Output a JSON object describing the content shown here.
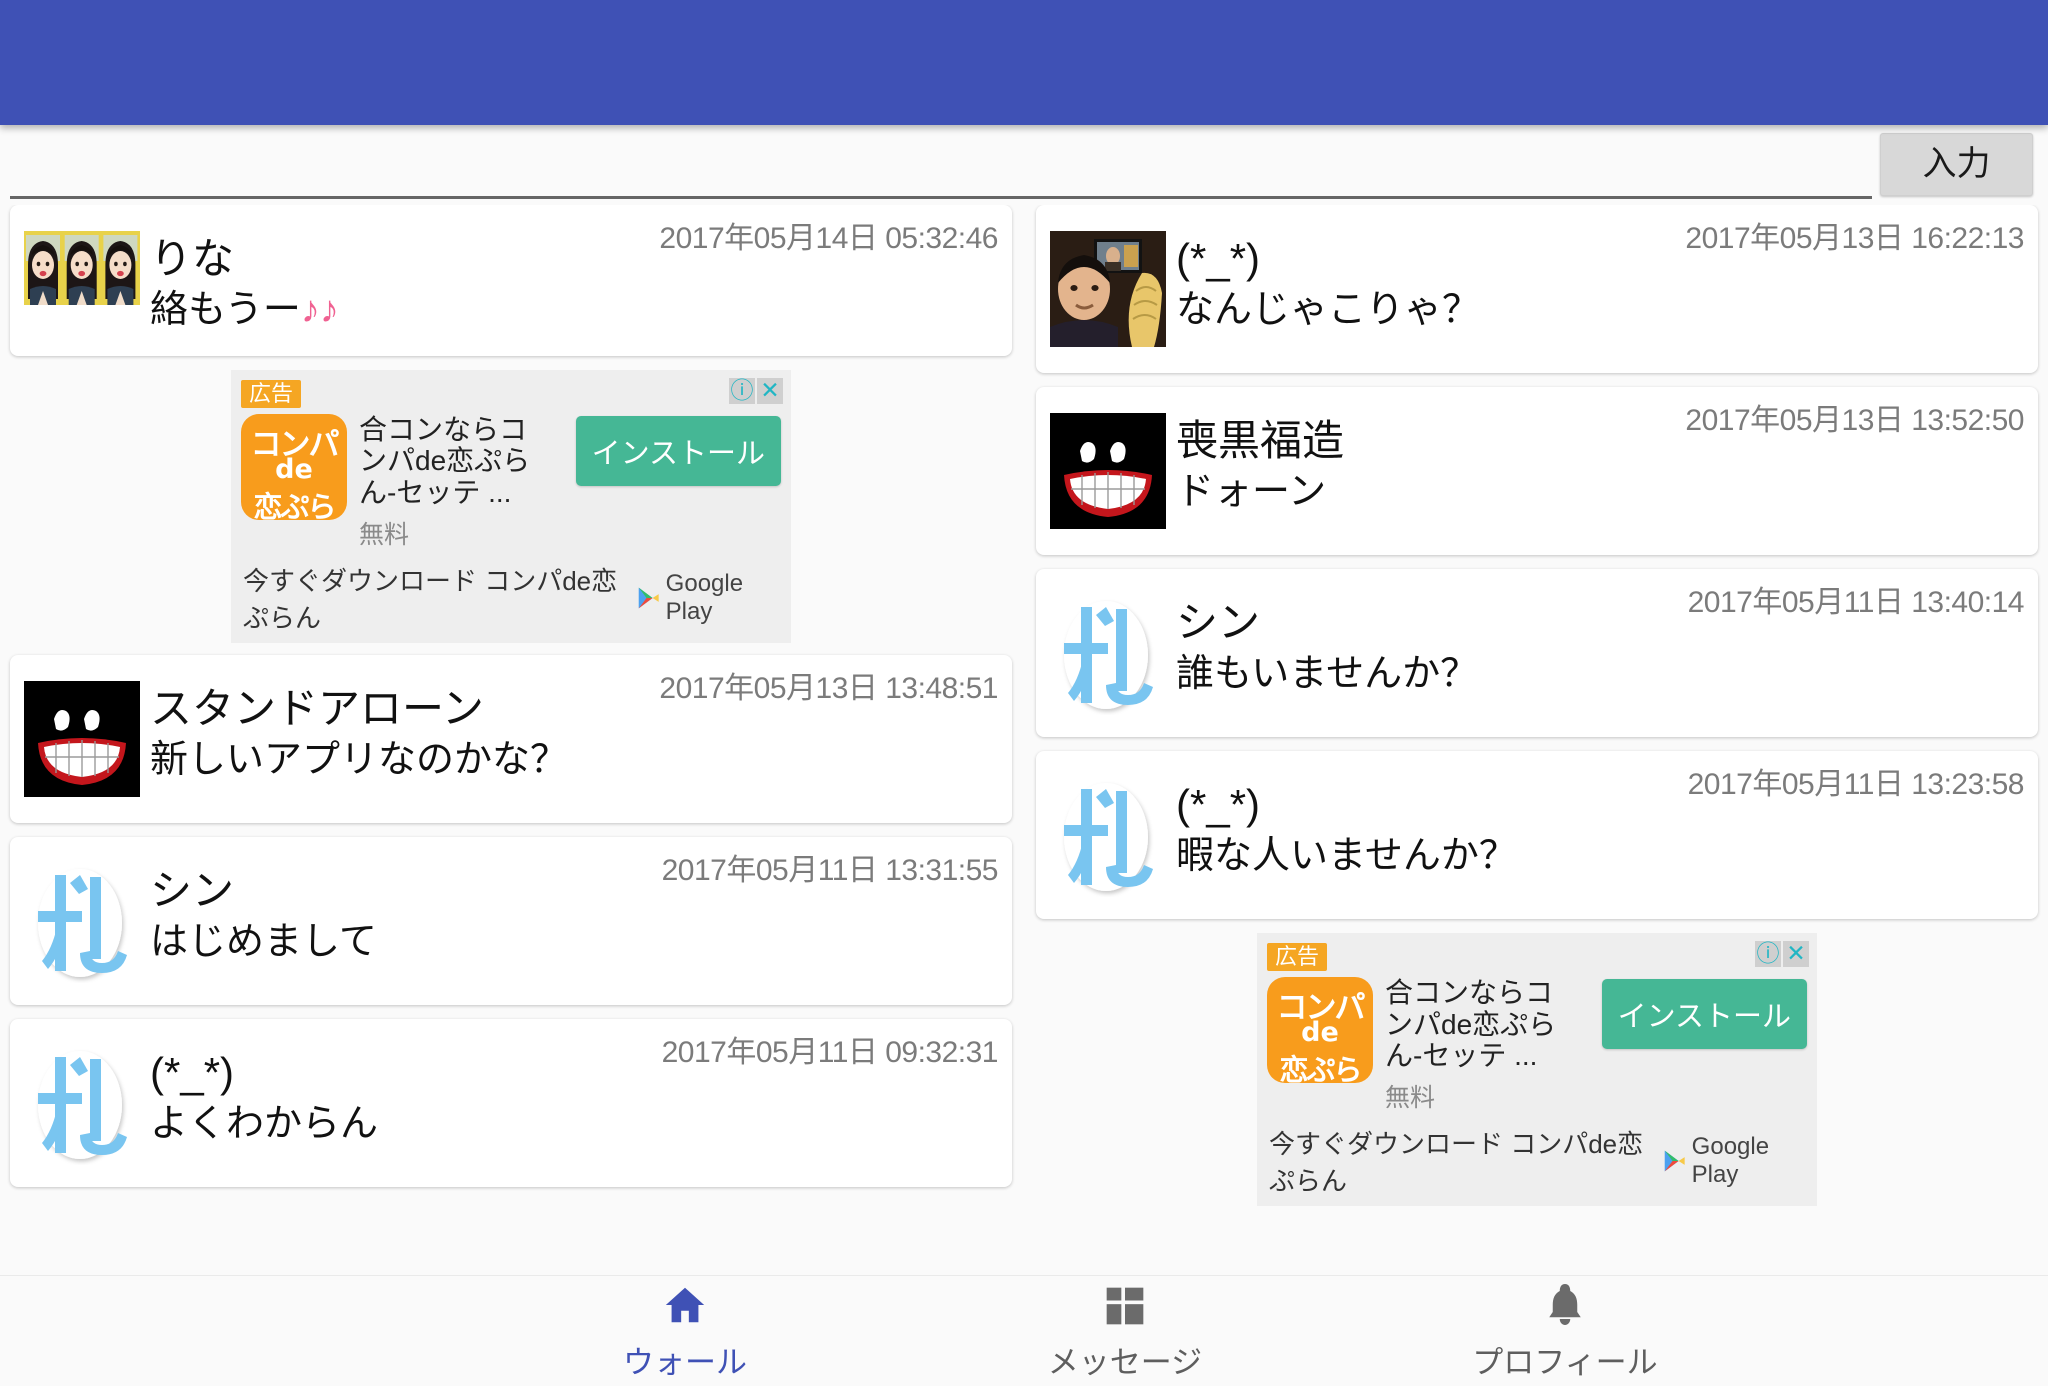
{
  "app": {
    "accent_color": "#3f51b5",
    "background_color": "#fafafa"
  },
  "composer": {
    "value": "",
    "placeholder": "",
    "submit_label": "入力"
  },
  "feed": {
    "left_column": [
      {
        "kind": "post",
        "avatar": "photo-rina",
        "name": "りな",
        "message": "絡もうー",
        "message_suffix": "♪♪",
        "timestamp": "2017年05月14日 05:32:46"
      },
      {
        "kind": "ad",
        "ad_ref": 0
      },
      {
        "kind": "post",
        "avatar": "black-grin",
        "name": "スタンドアローン",
        "message": "新しいアプリなのかな？",
        "message_suffix": "",
        "timestamp": "2017年05月13日 13:48:51"
      },
      {
        "kind": "post",
        "avatar": "fuda",
        "name": "シン",
        "message": "はじめまして",
        "message_suffix": "",
        "timestamp": "2017年05月11日 13:31:55"
      },
      {
        "kind": "post",
        "avatar": "fuda",
        "name": "(*_*)",
        "message": "よくわからん",
        "message_suffix": "",
        "timestamp": "2017年05月11日 09:32:31"
      }
    ],
    "right_column": [
      {
        "kind": "post",
        "avatar": "photo-man",
        "name": "(*_*)",
        "message": "なんじゃこりゃ？",
        "message_suffix": "",
        "timestamp": "2017年05月13日 16:22:13"
      },
      {
        "kind": "post",
        "avatar": "black-grin",
        "name": "喪黒福造",
        "message": "ドォーン",
        "message_suffix": "",
        "timestamp": "2017年05月13日 13:52:50"
      },
      {
        "kind": "post",
        "avatar": "fuda",
        "name": "シン",
        "message": "誰もいませんか？",
        "message_suffix": "",
        "timestamp": "2017年05月11日 13:40:14"
      },
      {
        "kind": "post",
        "avatar": "fuda",
        "name": "(*_*)",
        "message": "暇な人いませんか？",
        "message_suffix": "",
        "timestamp": "2017年05月11日 13:23:58"
      },
      {
        "kind": "ad",
        "ad_ref": 1
      }
    ]
  },
  "ads": [
    {
      "badge": "広告",
      "info_icon": "info-icon",
      "close_icon": "close-icon",
      "icon_line1": "コンパ",
      "icon_line2": "de",
      "icon_line3": "恋ぷらん",
      "title": "合コンならコンパde恋ぷらん-セッテ ...",
      "price": "無料",
      "install_label": "インストール",
      "footer_text": "今すぐダウンロード コンパde恋ぷらん",
      "store_label": "Google Play",
      "install_color": "#45b795",
      "badge_color": "#f5a623"
    },
    {
      "badge": "広告",
      "info_icon": "info-icon",
      "close_icon": "close-icon",
      "icon_line1": "コンパ",
      "icon_line2": "de",
      "icon_line3": "恋ぷらん",
      "title": "合コンならコンパde恋ぷらん-セッテ ...",
      "price": "無料",
      "install_label": "インストール",
      "footer_text": "今すぐダウンロード コンパde恋ぷらん",
      "store_label": "Google Play",
      "install_color": "#45b795",
      "badge_color": "#f5a623"
    }
  ],
  "bottom_nav": {
    "items": [
      {
        "label": "ウォール",
        "icon": "home-icon",
        "active": true
      },
      {
        "label": "メッセージ",
        "icon": "dashboard-icon",
        "active": false
      },
      {
        "label": "プロフィール",
        "icon": "bell-icon",
        "active": false
      }
    ]
  }
}
